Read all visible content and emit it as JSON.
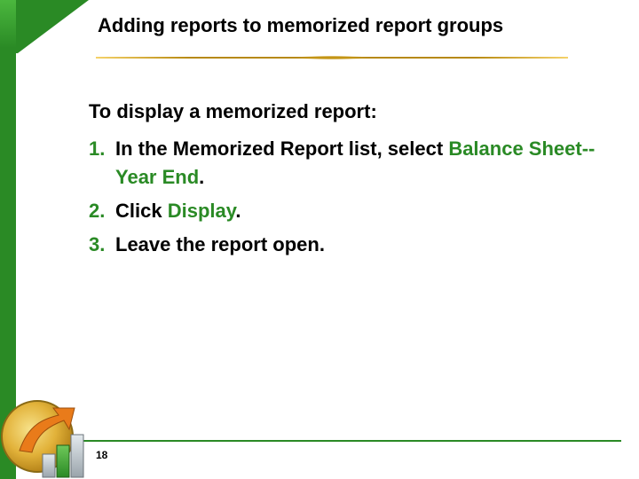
{
  "title": "Adding reports to memorized report groups",
  "intro": "To display a memorized report:",
  "steps": {
    "num1": "1.",
    "num2": "2.",
    "num3": "3.",
    "step1_a": "In the Memorized Report list, select ",
    "step1_b": "Balance Sheet--Year End",
    "step1_c": ".",
    "step2_a": "Click ",
    "step2_b": "Display",
    "step2_c": ".",
    "step3": "Leave the report open."
  },
  "page_number": "18"
}
